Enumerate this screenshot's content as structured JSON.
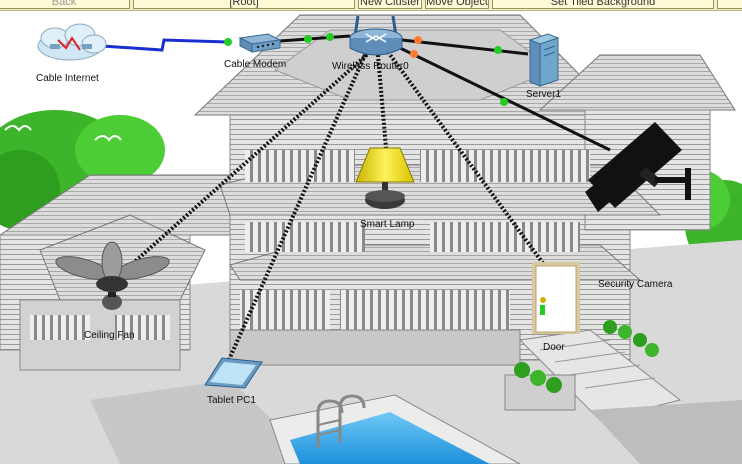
{
  "toolbar": {
    "back_label": "Back",
    "root_label": "[Root]",
    "new_cluster_label": "New Cluster",
    "move_object_label": "Move Object",
    "set_tiled_background_label": "Set Tiled Background"
  },
  "devices": {
    "cable_internet": "Cable Internet",
    "cable_modem": "Cable Modem",
    "wireless_router": "Wireless Router0",
    "server": "Server1",
    "smart_lamp": "Smart Lamp",
    "security_camera": "Security Camera",
    "ceiling_fan": "Ceiling Fan",
    "door": "Door",
    "tablet": "Tablet PC1"
  },
  "colors": {
    "link_up": "#22cc22",
    "link_down": "#ff7b2e",
    "cable_link": "#1a2fd0",
    "wireless_link": "#111111"
  }
}
